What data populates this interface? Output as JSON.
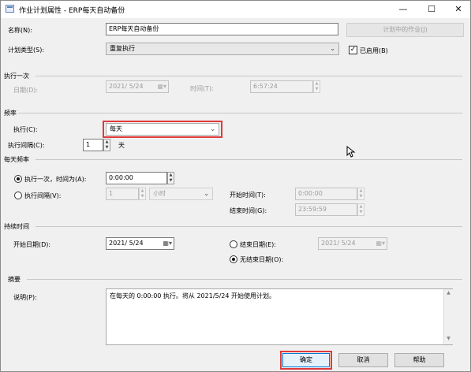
{
  "window": {
    "title": "作业计划属性 - ERP每天自动备份",
    "minimize": "—",
    "maximize": "☐",
    "close": "✕"
  },
  "header": {
    "name_label": "名称(N):",
    "name_value": "ERP每天自动备份",
    "jobs_button": "计划中的作业(J)",
    "schedule_type_label": "计划类型(S):",
    "schedule_type_value": "重复执行",
    "enabled_label": "已启用(B)",
    "enabled_check": "✓"
  },
  "one_time": {
    "section": "执行一次",
    "date_label": "日期(D):",
    "date_value": "2021/ 5/24",
    "time_label": "时间(T):",
    "time_value": "6:57:24"
  },
  "frequency": {
    "section": "频率",
    "occurs_label": "执行(C):",
    "occurs_value": "每天",
    "recurs_label": "执行间隔(C):",
    "recurs_value": "1",
    "recurs_unit": "天"
  },
  "daily_frequency": {
    "section": "每天频率",
    "once_label": "执行一次，时间为(A):",
    "once_time": "0:00:00",
    "every_label": "执行间隔(V):",
    "every_value": "1",
    "every_unit": "小时",
    "start_label": "开始时间(T):",
    "start_value": "0:00:00",
    "end_label": "结束时间(G):",
    "end_value": "23:59:59"
  },
  "duration": {
    "section": "持续时间",
    "start_label": "开始日期(D):",
    "start_value": "2021/ 5/24",
    "end_label": "结束日期(E):",
    "end_value": "2021/ 5/24",
    "no_end_label": "无结束日期(O):"
  },
  "summary": {
    "section": "摘要",
    "desc_label": "说明(P):",
    "desc_value": "在每天的 0:00:00 执行。将从 2021/5/24 开始使用计划。"
  },
  "buttons": {
    "ok": "确定",
    "cancel": "取消",
    "help": "帮助"
  },
  "symbols": {
    "dropdown": "⌄",
    "calendar": "▦▾",
    "spin_up": "▲",
    "spin_down": "▼"
  },
  "accent": {
    "highlight": "#e03a3a"
  }
}
